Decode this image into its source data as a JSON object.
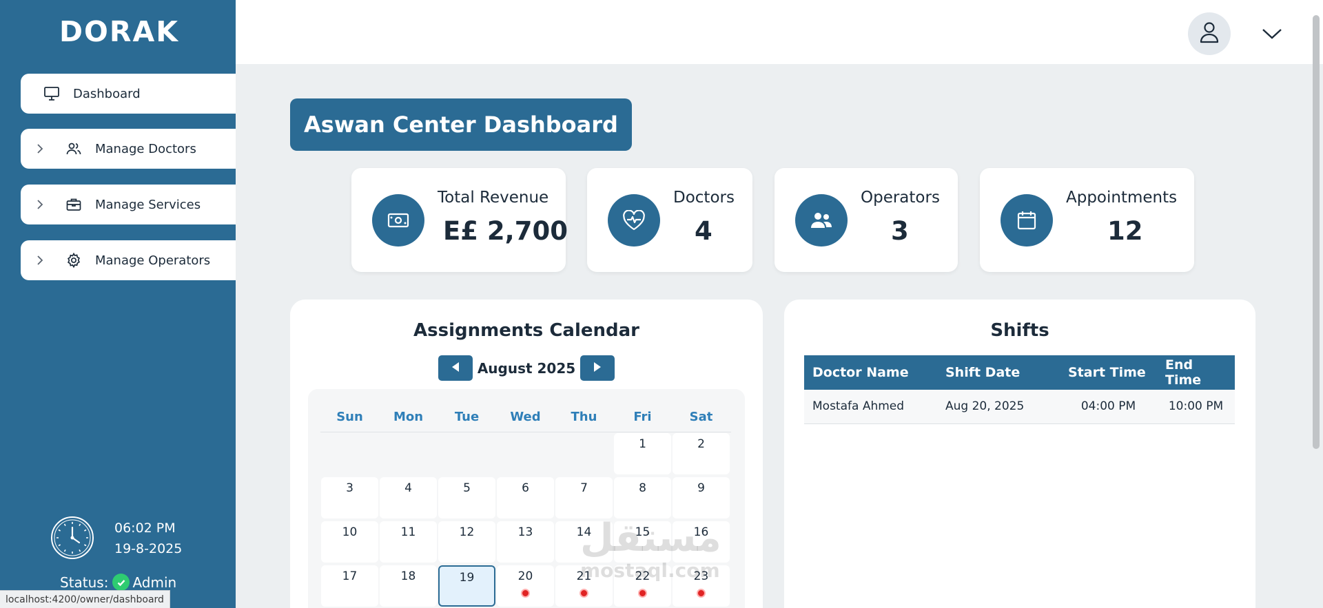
{
  "brand": "DORAK",
  "sidebar": {
    "items": [
      {
        "label": "Dashboard",
        "icon": "monitor-icon",
        "active": true
      },
      {
        "label": "Manage Doctors",
        "icon": "users-icon"
      },
      {
        "label": "Manage Services",
        "icon": "briefcase-icon"
      },
      {
        "label": "Manage Operators",
        "icon": "gear-icon"
      }
    ],
    "time": "06:02 PM",
    "date": "19-8-2025",
    "status_label": "Status:",
    "role": "Admin"
  },
  "url_status": "localhost:4200/owner/dashboard",
  "page_title": "Aswan Center Dashboard",
  "stats": [
    {
      "label": "Total Revenue",
      "value": "E£ 2,700",
      "icon": "cash-icon"
    },
    {
      "label": "Doctors",
      "value": "4",
      "icon": "heart-pulse-icon"
    },
    {
      "label": "Operators",
      "value": "3",
      "icon": "users-icon"
    },
    {
      "label": "Appointments",
      "value": "12",
      "icon": "calendar-icon"
    }
  ],
  "calendar": {
    "title": "Assignments Calendar",
    "month": "August 2025",
    "days_of_week": [
      "Sun",
      "Mon",
      "Tue",
      "Wed",
      "Thu",
      "Fri",
      "Sat"
    ],
    "days": [
      "1",
      "2",
      "3",
      "4",
      "5",
      "6",
      "7",
      "8",
      "9",
      "10",
      "11",
      "12",
      "13",
      "14",
      "15",
      "16",
      "17",
      "18",
      "19",
      "20",
      "21",
      "22",
      "23"
    ],
    "today": "19",
    "days_with_shifts": [
      "20",
      "21",
      "22",
      "23"
    ]
  },
  "shifts": {
    "title": "Shifts",
    "columns": [
      "Doctor Name",
      "Shift Date",
      "Start Time",
      "End Time"
    ],
    "rows": [
      [
        "Mostafa Ahmed",
        "Aug 20, 2025",
        "04:00 PM",
        "10:00 PM"
      ]
    ]
  },
  "watermark": {
    "arabic": "مستقل",
    "latin": "mostaql.com"
  },
  "colors": {
    "primary": "#2b6b94",
    "accent_text": "#2f7fb8",
    "background": "#eceff1",
    "shift_dot": "#e02424",
    "status_ok": "#2ecc71"
  }
}
